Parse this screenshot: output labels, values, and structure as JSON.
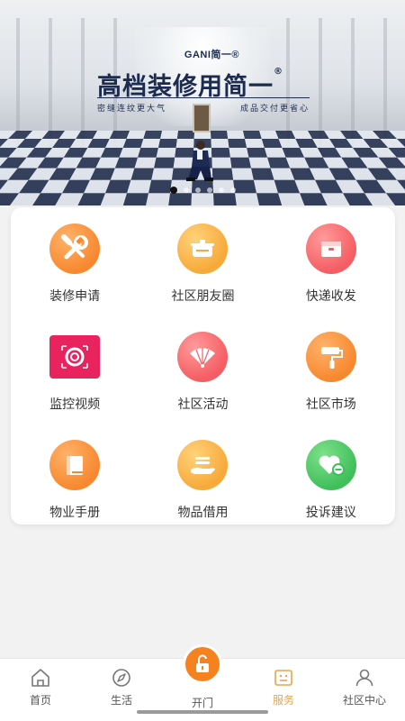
{
  "banner": {
    "brand": "GANI简一®",
    "headline": "高档装修用简一",
    "headline_mark": "®",
    "tagline_left": "密缝连纹更大气",
    "tagline_right": "成品交付更省心",
    "slide_count": 6,
    "active_slide": 0
  },
  "services": [
    {
      "label": "装修申请",
      "icon": "wrench-screwdriver-icon",
      "color": "#f7882f"
    },
    {
      "label": "社区朋友圈",
      "icon": "cooking-pot-icon",
      "color": "#f7a93a"
    },
    {
      "label": "快递收发",
      "icon": "package-box-icon",
      "color": "#f45d63"
    },
    {
      "label": "监控视频",
      "icon": "camera-lens-icon",
      "color": "#e8235e"
    },
    {
      "label": "社区活动",
      "icon": "folding-fan-icon",
      "color": "#f45d63"
    },
    {
      "label": "社区市场",
      "icon": "paint-roller-icon",
      "color": "#f7882f"
    },
    {
      "label": "物业手册",
      "icon": "book-icon",
      "color": "#f7882f"
    },
    {
      "label": "物品借用",
      "icon": "hand-giving-icon",
      "color": "#f7a93a"
    },
    {
      "label": "投诉建议",
      "icon": "heart-minus-icon",
      "color": "#3fbf5a"
    }
  ],
  "nav": {
    "home": "首页",
    "life": "生活",
    "open": "开门",
    "service": "服务",
    "profile": "社区中心",
    "active_color": "#e8a44a"
  }
}
